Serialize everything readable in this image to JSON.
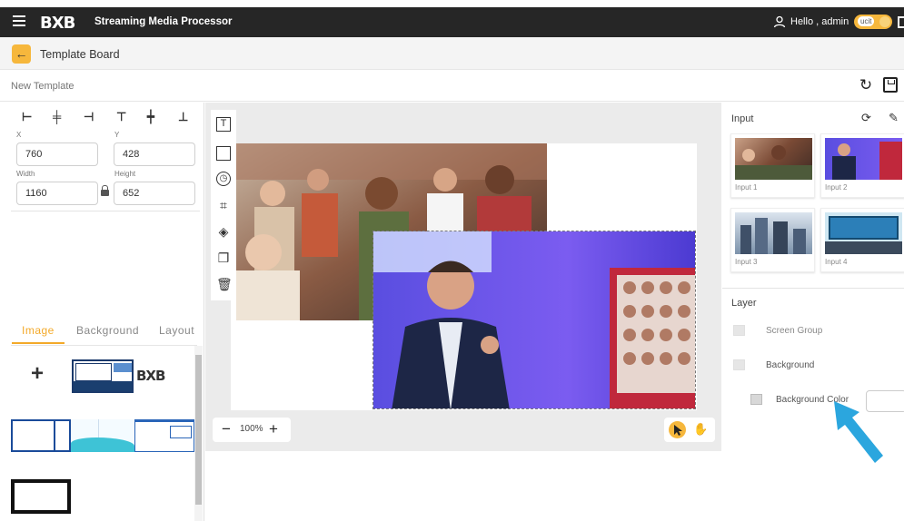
{
  "header": {
    "logo": "BXB",
    "app_title": "Streaming Media Processor",
    "greeting": "Hello , admin",
    "toggle_label": "ucit"
  },
  "subheader": {
    "title": "Template Board"
  },
  "template": {
    "name_placeholder": "New Template"
  },
  "properties": {
    "x_label": "X",
    "x_value": "760",
    "y_label": "Y",
    "y_value": "428",
    "width_label": "Width",
    "width_value": "1160",
    "height_label": "Height",
    "height_value": "652"
  },
  "left_tabs": [
    "Image",
    "Background",
    "Layout"
  ],
  "active_tab": "Image",
  "canvas": {
    "zoom": "100%"
  },
  "right_panel": {
    "input_title": "Input",
    "inputs": [
      "Input 1",
      "Input 2",
      "Input 3",
      "Input 4"
    ],
    "layer_title": "Layer",
    "layers": [
      "Screen Group",
      "Background",
      "Background Color"
    ]
  },
  "colors": {
    "accent": "#f6b73c",
    "topbar": "#262626",
    "arrow": "#2ba6de"
  },
  "icons": [
    "menu-icon",
    "user-icon",
    "back-arrow-icon",
    "refresh-icon",
    "save-icon",
    "lock-icon",
    "text-tool-icon",
    "rectangle-tool-icon",
    "clock-tool-icon",
    "crop-tool-icon",
    "layers-tool-icon",
    "copy-tool-icon",
    "delete-tool-icon",
    "sync-icon",
    "edit-icon",
    "pointer-icon",
    "hand-icon"
  ]
}
